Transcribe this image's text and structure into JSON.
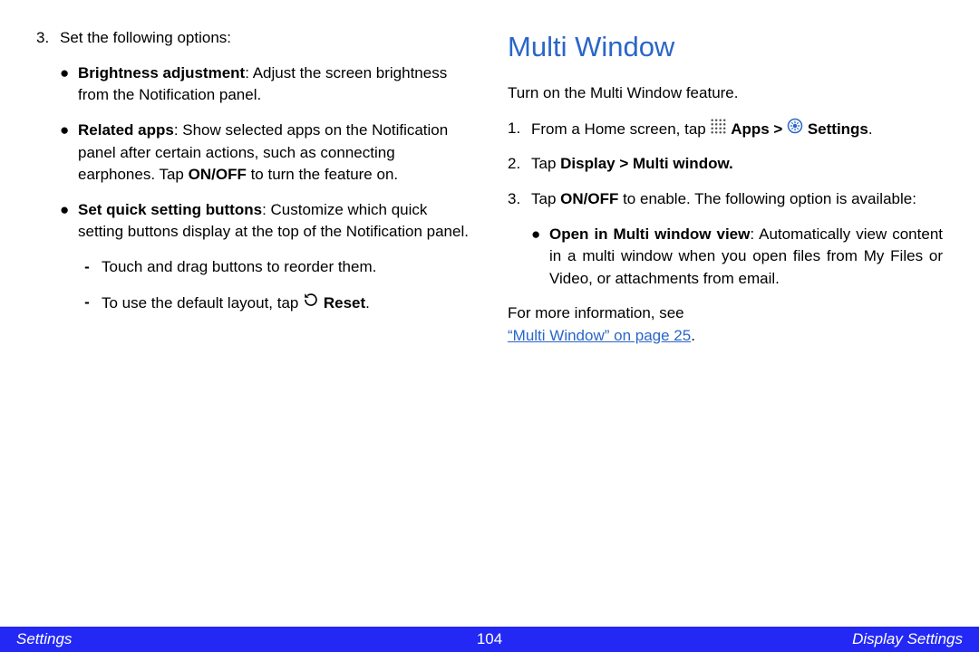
{
  "left": {
    "step3_num": "3.",
    "step3_text": "Set the following options:",
    "b1_lead": "Brightness adjustment",
    "b1_rest": ": Adjust the screen brightness from the Notification panel.",
    "b2_lead": "Related apps",
    "b2_rest_a": ": Show selected apps on the Notification panel after certain actions, such as connecting earphones. Tap ",
    "b2_onoff": "ON/OFF",
    "b2_rest_b": " to turn the feature on.",
    "b3_lead": "Set quick setting buttons",
    "b3_rest": ": Customize which quick setting buttons display at the top of the Notification panel.",
    "d1": "Touch and drag buttons to reorder them.",
    "d2_a": "To use the default layout, tap ",
    "d2_reset": "Reset",
    "d2_b": "."
  },
  "right": {
    "heading": "Multi Window",
    "intro": "Turn on the Multi Window feature.",
    "s1_num": "1.",
    "s1_a": "From a Home screen, tap ",
    "s1_apps": "Apps >",
    "s1_settings": "Settings",
    "s1_dot": ".",
    "s2_num": "2.",
    "s2_a": "Tap ",
    "s2_b": "Display > Multi window.",
    "s3_num": "3.",
    "s3_a": "Tap ",
    "s3_onoff": "ON/OFF",
    "s3_b": " to enable. The following option is available:",
    "sb_lead": "Open in Multi window view",
    "sb_rest": ": Automatically view content in a multi window when you open files from My Files or Video, or attachments from email.",
    "more_a": "For more information, see",
    "link": "“Multi Window” on page 25",
    "more_b": "."
  },
  "footer": {
    "left": "Settings",
    "center": "104",
    "right": "Display Settings"
  }
}
